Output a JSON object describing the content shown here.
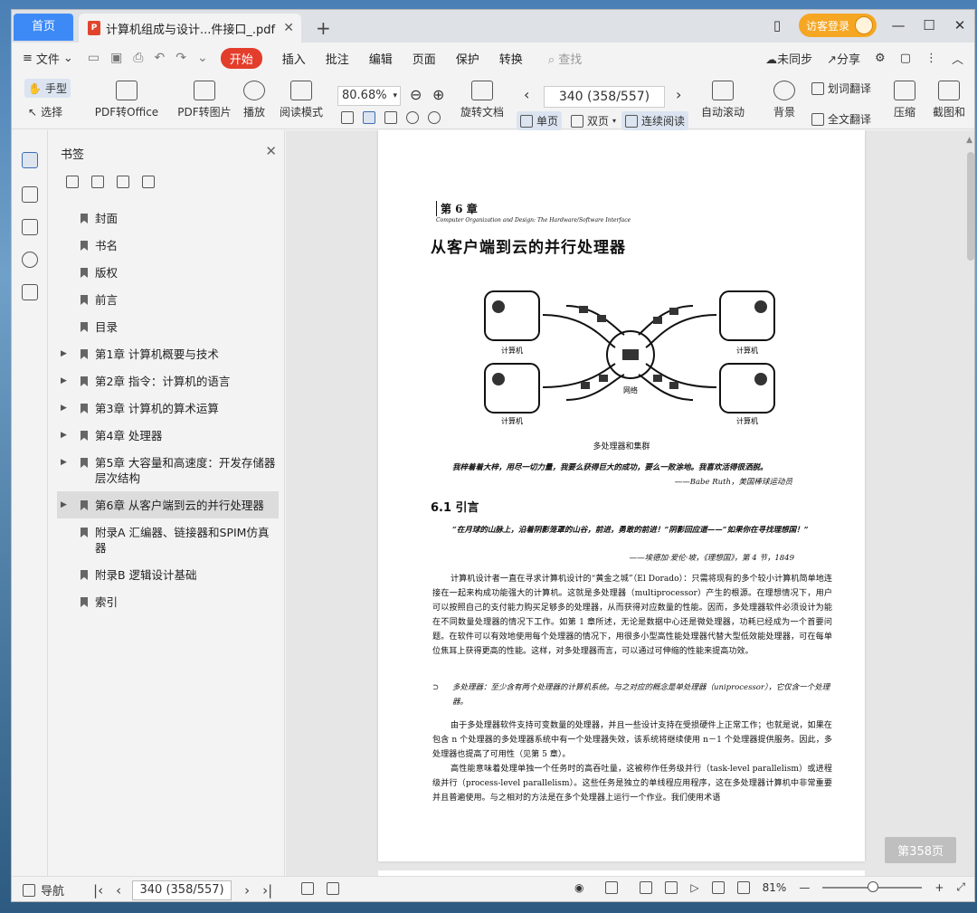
{
  "titlebar": {
    "home_tab": "首页",
    "doc_tab_title": "计算机组成与设计...件接口_.pdf",
    "login_label": "访客登录"
  },
  "menubar": {
    "file": "文件",
    "items": [
      "开始",
      "插入",
      "批注",
      "编辑",
      "页面",
      "保护",
      "转换"
    ],
    "search_placeholder": "查找",
    "unsynced": "未同步",
    "share": "分享"
  },
  "toolbar": {
    "hand_tool": "手型",
    "select_tool": "选择",
    "pdf_to_office": "PDF转Office",
    "pdf_to_image": "PDF转图片",
    "play": "播放",
    "read_mode": "阅读模式",
    "zoom": "80.68%",
    "rotate_doc": "旋转文档",
    "page_indicator": "340 (358/557)",
    "single_page": "单页",
    "double_page": "双页",
    "continuous": "连续阅读",
    "auto_scroll": "自动滚动",
    "background": "背景",
    "word_translate": "划词翻译",
    "full_translate": "全文翻译",
    "compress": "压缩",
    "screenshot": "截图和"
  },
  "bookmarks": {
    "title": "书签",
    "items": [
      {
        "label": "封面"
      },
      {
        "label": "书名"
      },
      {
        "label": "版权"
      },
      {
        "label": "前言"
      },
      {
        "label": "目录"
      },
      {
        "label": "第1章  计算机概要与技术"
      },
      {
        "label": "第2章  指令：计算机的语言"
      },
      {
        "label": "第3章  计算机的算术运算"
      },
      {
        "label": "第4章  处理器"
      },
      {
        "label": "第5章  大容量和高速度：开发存储器层次结构"
      },
      {
        "label": "第6章  从客户端到云的并行处理器"
      },
      {
        "label": "附录A  汇编器、链接器和SPIM仿真器"
      },
      {
        "label": "附录B  逻辑设计基础"
      },
      {
        "label": "索引"
      }
    ]
  },
  "page": {
    "chapter_no": "第 6 章",
    "chapter_sub": "Computer Organization and Design: The Hardware/Software Interface",
    "chapter_title": "从客户端到云的并行处理器",
    "fig_label_computer": "计算机",
    "fig_label_network": "网络",
    "fig_caption": "多处理器和集群",
    "quote1": "我梓着着大梓，用尽一切力量，我要么获得巨大的成功，要么一败涂地。我喜欢活得很洒脱。",
    "quote1_attr": "——Babe Ruth，美国棒球运动员",
    "section": "6.1   引言",
    "quote2": "“在月球的山脉上，沿着阴影笼罩的山谷，前进，勇敢的前进！”阴影回应道——“如果你在寻找理想国！”",
    "quote2_attr": "——埃德加·爱伦·坡，《理想国》，第 4 节，1849",
    "para1": "计算机设计者一直在寻求计算机设计的“黄金之城”（El Dorado）：只需将现有的多个较小计算机简单地连接在一起来构成功能强大的计算机。这就是多处理器（multiprocessor）产生的根源。在理想情况下，用户可以按照自己的支付能力购买足够多的处理器，从而获得对应数量的性能。因而，多处理器软件必须设计为能在不同数量处理器的情况下工作。如第 1 章所述，无论是数据中心还是微处理器，功耗已经成为一个首要问题。在软件可以有效地使用每个处理器的情况下，用很多小型高性能处理器代替大型低效能处理器，可在每单位焦耳上获得更高的性能。这样，对多处理器而言，可以通过可伸缩的性能来提高功效。",
    "note": "多处理器：至少含有两个处理器的计算机系统。与之对应的概念是单处理器（uniprocessor），它仅含一个处理器。",
    "para2": "由于多处理器软件支持可变数量的处理器，并且一些设计支持在受损硬件上正常工作；也就是说，如果在包含 n 个处理器的多处理器系统中有一个处理器失效，该系统将继续使用 n－1 个处理器提供服务。因此，多处理器也提高了可用性（见第 5 章）。",
    "para3": "高性能意味着处理单独一个任务时的高吞吐量，这被称作任务级并行（task-level parallelism）或进程级并行（process-level parallelism）。这些任务是独立的单线程应用程序，这在多处理器计算机中非常重要并且普遍使用。与之相对的方法是在多个处理器上运行一个作业。我们使用术语",
    "page_badge": "第358页"
  },
  "statusbar": {
    "nav": "导航",
    "page_indicator": "340 (358/557)",
    "zoom": "81%"
  },
  "colors": {
    "accent_blue": "#3d8af7",
    "accent_red": "#e33d2b",
    "login_orange": "#f5a623"
  }
}
